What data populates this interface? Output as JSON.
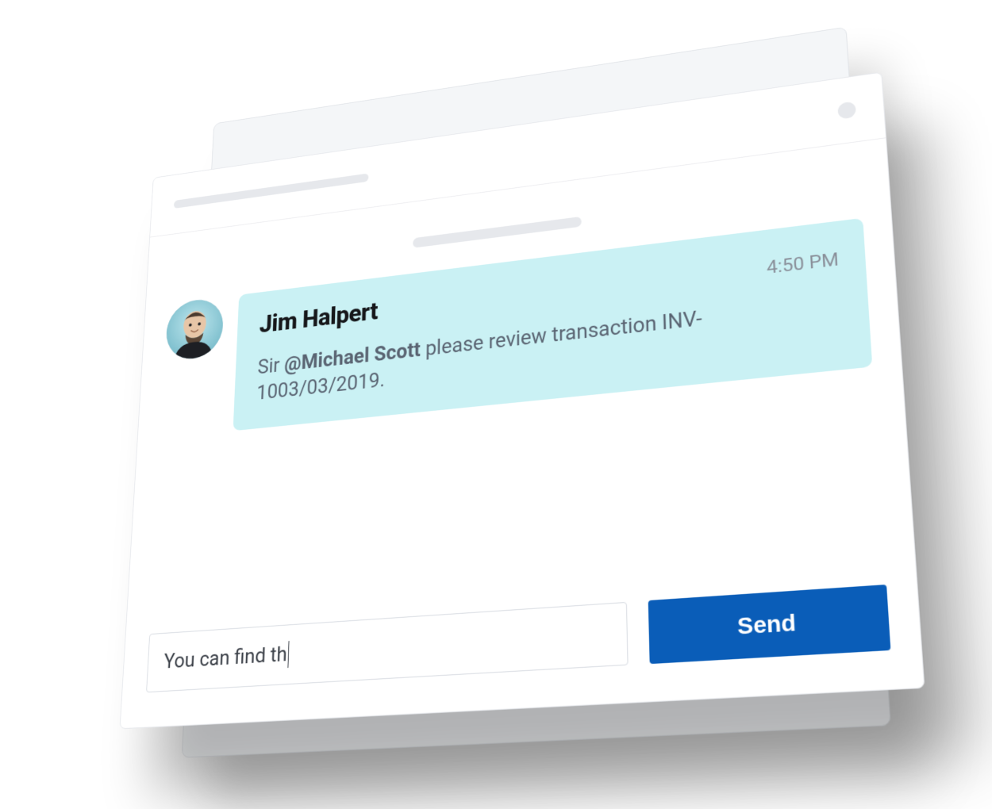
{
  "message": {
    "sender": "Jim Halpert",
    "timestamp": "4:50 PM",
    "body_prefix": "Sir ",
    "mention": "@Michael Scott",
    "body_suffix": " please review transaction INV-1003/03/2019."
  },
  "compose": {
    "value": "You can find th",
    "send_label": "Send"
  },
  "colors": {
    "bubble": "#caf1f4",
    "send_button": "#0a5db8"
  }
}
